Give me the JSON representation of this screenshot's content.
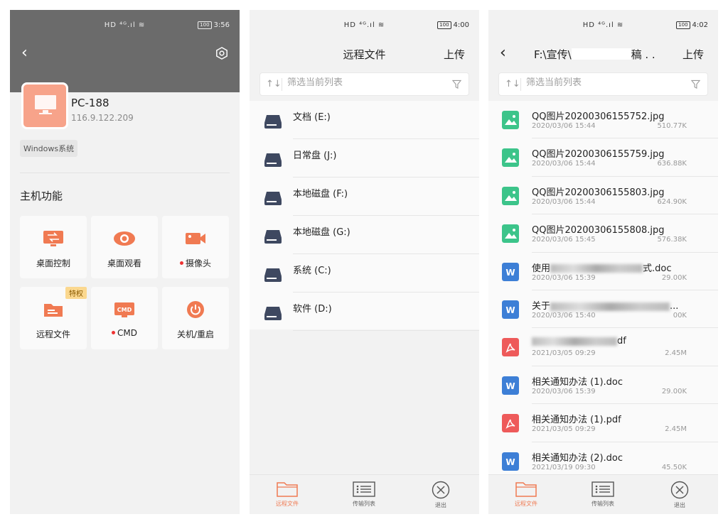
{
  "status": {
    "indicators": "HD ⁴ᴳ.ıl ≋",
    "battery": "100",
    "screen1_time": "3:56",
    "screen2_time": "4:00",
    "screen3_time": "4:02"
  },
  "device": {
    "name": "PC-188",
    "ip": "116.9.122.209",
    "os_tag": "Windows系统"
  },
  "functions": {
    "section_title": "主机功能",
    "badge": "特权",
    "items": [
      {
        "label": "桌面控制",
        "icon": "desktop-control-icon"
      },
      {
        "label": "桌面观看",
        "icon": "eye-icon"
      },
      {
        "label": "摄像头",
        "icon": "camera-icon",
        "dot": true
      },
      {
        "label": "远程文件",
        "icon": "folder-icon",
        "badge": true
      },
      {
        "label": "CMD",
        "icon": "cmd-icon",
        "dot": true
      },
      {
        "label": "关机/重启",
        "icon": "power-icon"
      }
    ]
  },
  "remote_files": {
    "title": "远程文件",
    "upload": "上传",
    "filter_placeholder": "筛选当前列表",
    "drives": [
      {
        "name": "文档 (E:)"
      },
      {
        "name": "日常盘 (J:)"
      },
      {
        "name": "本地磁盘 (F:)"
      },
      {
        "name": "本地磁盘 (G:)"
      },
      {
        "name": "系统 (C:)"
      },
      {
        "name": "软件 (D:)"
      }
    ]
  },
  "folder_view": {
    "path_prefix": "F:\\宣传\\",
    "path_suffix": "稿 . .",
    "upload": "上传",
    "filter_placeholder": "筛选当前列表",
    "files": [
      {
        "name": "QQ图片20200306155752.jpg",
        "date": "2020/03/06 15:44",
        "size": "510.77K",
        "type": "image"
      },
      {
        "name": "QQ图片20200306155759.jpg",
        "date": "2020/03/06 15:44",
        "size": "636.88K",
        "type": "image"
      },
      {
        "name": "QQ图片20200306155803.jpg",
        "date": "2020/03/06 15:44",
        "size": "624.90K",
        "type": "image"
      },
      {
        "name": "QQ图片20200306155808.jpg",
        "date": "2020/03/06 15:45",
        "size": "576.38K",
        "type": "image"
      },
      {
        "name_prefix": "使用",
        "name_suffix": "式.doc",
        "date": "2020/03/06 15:39",
        "size": "29.00K",
        "type": "word",
        "redacted": true
      },
      {
        "name_prefix": "关于",
        "name_suffix": "...",
        "date": "2020/03/06 15:40",
        "size": "00K",
        "type": "word",
        "redacted": true
      },
      {
        "name_prefix": "",
        "name_suffix": "df",
        "date": "2021/03/05 09:29",
        "size": "2.45M",
        "type": "pdf",
        "redacted": true
      },
      {
        "name": "相关通知办法 (1).doc",
        "date": "2020/03/06 15:39",
        "size": "29.00K",
        "type": "word"
      },
      {
        "name": "相关通知办法 (1).pdf",
        "date": "2021/03/05 09:29",
        "size": "2.45M",
        "type": "pdf"
      },
      {
        "name": "相关通知办法 (2).doc",
        "date": "2021/03/19 09:30",
        "size": "45.50K",
        "type": "word"
      }
    ]
  },
  "bottom_nav": [
    {
      "label": "远程文件",
      "icon": "folder-icon",
      "active": true
    },
    {
      "label": "传输列表",
      "icon": "list-icon"
    },
    {
      "label": "退出",
      "icon": "close-circle-icon"
    }
  ],
  "colors": {
    "accent": "#f07a52",
    "image_icon": "#3cc48a",
    "word_icon": "#3d7fd6",
    "pdf_icon": "#ee5a5a"
  }
}
